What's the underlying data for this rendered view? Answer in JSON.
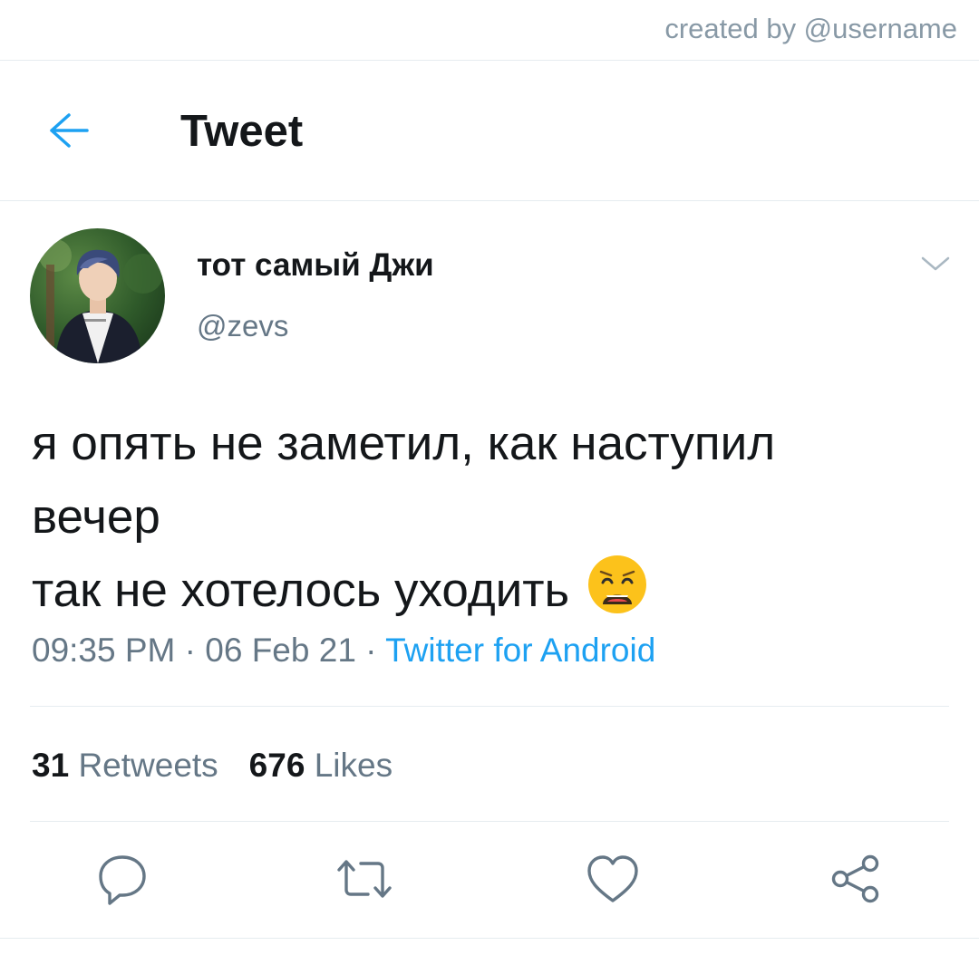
{
  "credit": "created by @username",
  "header": {
    "title": "Tweet",
    "back_icon": "arrow-left-icon"
  },
  "author": {
    "name": "тот самый Джи",
    "handle": "@zevs",
    "avatar": "profile-photo"
  },
  "tweet": {
    "lines": [
      "я опять не заметил, как наступил",
      "вечер",
      "так не хотелось уходить"
    ],
    "emoji": "weary-face-emoji"
  },
  "meta": {
    "time": "09:35 PM",
    "separator": " · ",
    "date": "06 Feb 21",
    "source": "Twitter for Android"
  },
  "stats": {
    "retweets_count": "31",
    "retweets_label": "Retweets",
    "likes_count": "676",
    "likes_label": "Likes"
  },
  "actions": [
    "reply-icon",
    "retweet-icon",
    "like-icon",
    "share-icon"
  ],
  "colors": {
    "accent": "#1da1f2",
    "text": "#14171a",
    "muted": "#657786",
    "border": "#e6ecf0"
  }
}
